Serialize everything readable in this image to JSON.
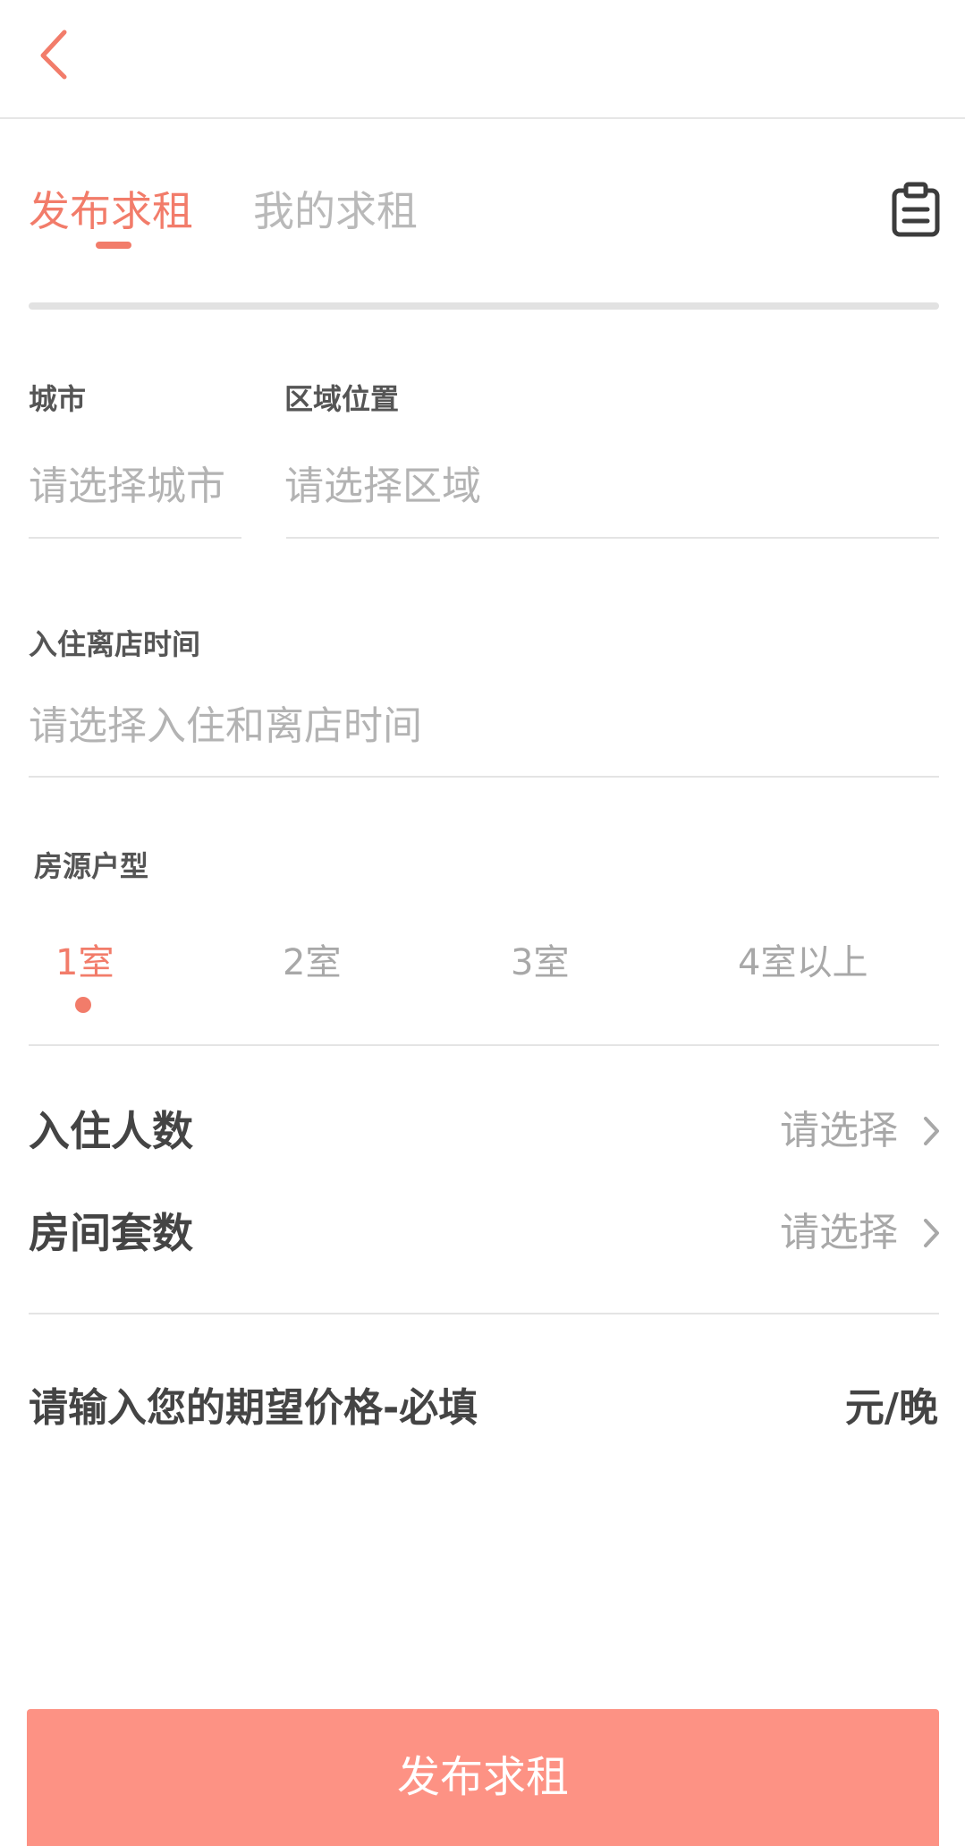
{
  "tabs": {
    "publish": "发布求租",
    "mine": "我的求租"
  },
  "city": {
    "label": "城市",
    "placeholder": "请选择城市"
  },
  "area": {
    "label": "区域位置",
    "placeholder": "请选择区域"
  },
  "stay_time": {
    "label": "入住离店时间",
    "placeholder": "请选择入住和离店时间"
  },
  "room_type": {
    "label": "房源户型",
    "options": [
      "1室",
      "2室",
      "3室",
      "4室以上"
    ],
    "selected": "1室"
  },
  "guests": {
    "label": "入住人数",
    "value": "请选择"
  },
  "rooms": {
    "label": "房间套数",
    "value": "请选择"
  },
  "price": {
    "label": "请输入您的期望价格-必填",
    "unit": "元/晚"
  },
  "submit": {
    "label": "发布求租"
  },
  "colors": {
    "accent": "#f27c6a",
    "button": "#fd9284"
  },
  "icons": {
    "back": "chevron-left-icon",
    "clipboard": "clipboard-icon",
    "row_arrow": "chevron-right-icon"
  }
}
